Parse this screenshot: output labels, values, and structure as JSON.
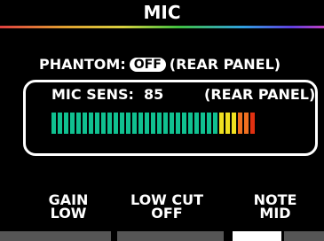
{
  "screen": {
    "title": "MIC"
  },
  "phantom": {
    "label": "PHANTOM:",
    "state": "OFF",
    "note": "(REAR PANEL)"
  },
  "mic_sens": {
    "label": "MIC SENS:",
    "value": "85",
    "note": "(REAR PANEL)",
    "level_fraction": 0.82
  },
  "softkeys": [
    {
      "line1": "GAIN",
      "line2": "LOW"
    },
    {
      "line1": "LOW CUT",
      "line2": "OFF"
    },
    {
      "line1": "NOTE",
      "line2": "MID"
    }
  ],
  "colors": {
    "meter_green": "#10c090",
    "meter_yellow": "#f0e020",
    "meter_orange": "#f07020",
    "meter_red": "#e03010"
  }
}
